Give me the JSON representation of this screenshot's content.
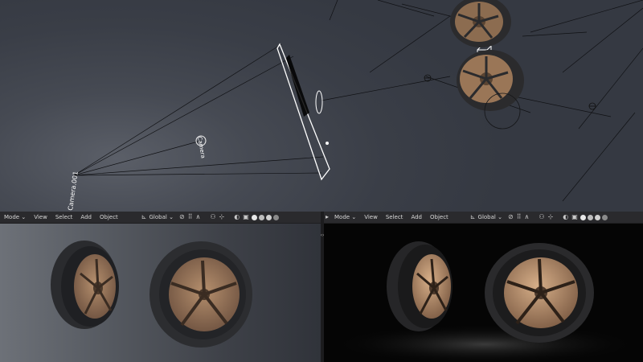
{
  "top_viewport": {
    "object_labels": [
      "Camera.001",
      "Camera"
    ]
  },
  "left_header": {
    "mode_label": "Mode",
    "menus": [
      "View",
      "Select",
      "Add",
      "Object"
    ],
    "orientation_label": "Global"
  },
  "right_header": {
    "mode_label": "Mode",
    "menus": [
      "View",
      "Select",
      "Add",
      "Object"
    ],
    "orientation_label": "Global"
  },
  "split_handle_label": "‹›",
  "colors": {
    "tire": "#2c2c2e",
    "rim": "#a47f5f",
    "rim_dark": "#6b4f3a",
    "header": "#2a2a2d",
    "render_bg": "#050505"
  }
}
